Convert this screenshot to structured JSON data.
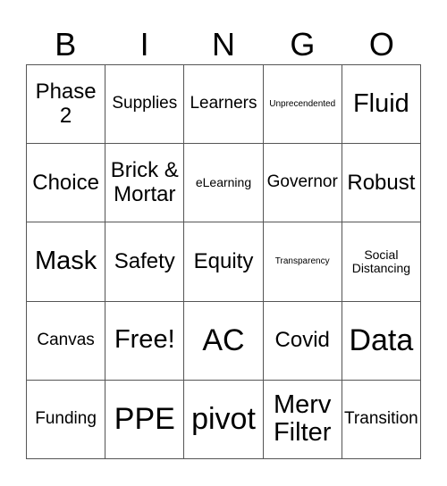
{
  "header": [
    "B",
    "I",
    "N",
    "G",
    "O"
  ],
  "cells": [
    {
      "text": "Phase 2",
      "size": "lg"
    },
    {
      "text": "Supplies",
      "size": "md"
    },
    {
      "text": "Learners",
      "size": "md"
    },
    {
      "text": "Unprecendented",
      "size": "xs"
    },
    {
      "text": "Fluid",
      "size": "xl"
    },
    {
      "text": "Choice",
      "size": "lg"
    },
    {
      "text": "Brick & Mortar",
      "size": "lg"
    },
    {
      "text": "eLearning",
      "size": "sm"
    },
    {
      "text": "Governor",
      "size": "md"
    },
    {
      "text": "Robust",
      "size": "lg"
    },
    {
      "text": "Mask",
      "size": "xl"
    },
    {
      "text": "Safety",
      "size": "lg"
    },
    {
      "text": "Equity",
      "size": "lg"
    },
    {
      "text": "Transparency",
      "size": "xs"
    },
    {
      "text": "Social Distancing",
      "size": "sm"
    },
    {
      "text": "Canvas",
      "size": "md"
    },
    {
      "text": "Free!",
      "size": "xl"
    },
    {
      "text": "AC",
      "size": "xxl"
    },
    {
      "text": "Covid",
      "size": "lg"
    },
    {
      "text": "Data",
      "size": "xxl"
    },
    {
      "text": "Funding",
      "size": "md"
    },
    {
      "text": "PPE",
      "size": "xxl"
    },
    {
      "text": "pivot",
      "size": "xxl"
    },
    {
      "text": "Merv Filter",
      "size": "xl"
    },
    {
      "text": "Transition",
      "size": "md"
    }
  ]
}
